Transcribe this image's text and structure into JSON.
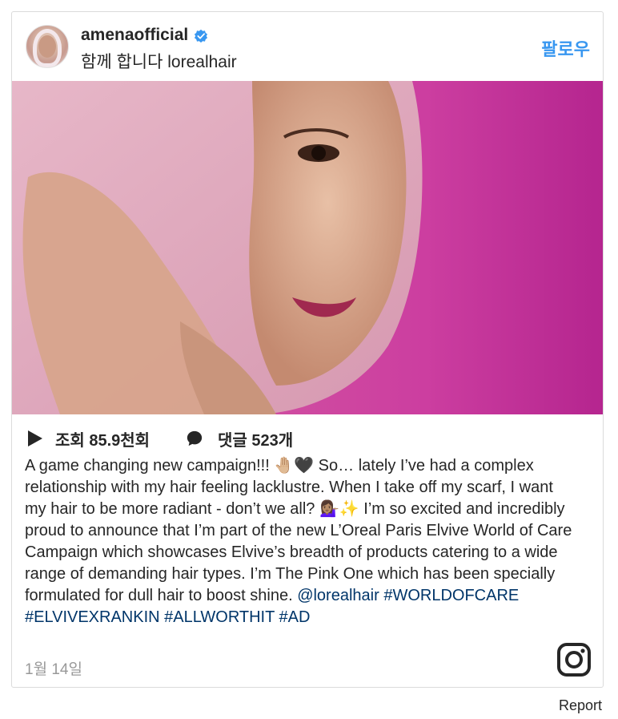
{
  "header": {
    "username": "amenaofficial",
    "subtitle": "함께 합니다 lorealhair",
    "follow_label": "팔로우",
    "verified_icon": "verified-badge-icon"
  },
  "stats": {
    "views": "조회 85.9천회",
    "comments": "댓글 523개"
  },
  "caption": {
    "text": "A game changing new campaign!!! 🤚🏼🖤 So… lately I’ve had a complex relationship with my hair feeling lacklustre. When I take off my scarf, I want my hair to be more radiant - don’t we all? 💁🏽‍♀️✨ I’m so excited and incredibly proud to announce that I’m part of the new L’Oreal Paris Elvive World of Care Campaign which showcases Elvive’s breadth of products catering to a wide range of demanding hair types. I’m The Pink One which has been specially formulated for dull hair to boost shine. ",
    "mention": "@lorealhair",
    "hashtags": [
      "#WORLDOFCARE",
      "#ELVIVEXRANKIN",
      "#ALLWORTHIT",
      "#AD"
    ]
  },
  "date": "1월 14일",
  "footer": {
    "report_label": "Report"
  },
  "colors": {
    "accent": "#3897f0",
    "link": "#003569",
    "muted": "#999999",
    "photo_bg": "#cc3ea0"
  }
}
